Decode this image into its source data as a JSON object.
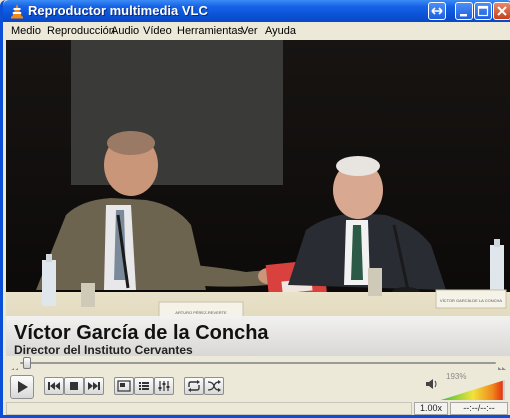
{
  "window": {
    "title": "Reproductor multimedia VLC"
  },
  "menu": [
    "Medio",
    "Reproducción",
    "Audio",
    "Vídeo",
    "Herramientas",
    "Ver",
    "Ayuda"
  ],
  "video": {
    "caption_name": "Víctor García de la Concha",
    "caption_role": "Director del Instituto Cervantes",
    "nameplate_left": "ARTURO PÉREZ-REVERTE",
    "nameplate_right": "VÍCTOR GARCÍA DE LA CONCHA"
  },
  "playback": {
    "position_fraction": 0.0
  },
  "volume": {
    "label": "193%",
    "fraction": 0.965
  },
  "status": {
    "speed": "1.00x",
    "time": "--:--/--:--"
  },
  "colors": {
    "titlebar": "#0a52d6",
    "accent_orange": "#f08a1c",
    "volume_red": "#e02010",
    "volume_green": "#3cc23c"
  }
}
